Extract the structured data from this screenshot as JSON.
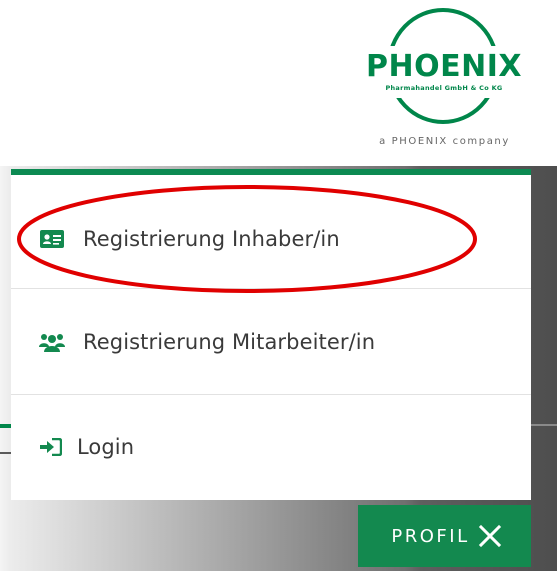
{
  "logo": {
    "name": "PHOENIX",
    "subtitle": "Pharmahandel GmbH & Co KG",
    "company_line": "a PHOENIX company",
    "brand_color": "#00864a"
  },
  "menu": {
    "accent_color": "#0c8a52",
    "items": [
      {
        "label": "Registrierung Inhaber/in",
        "icon": "id-card-icon"
      },
      {
        "label": "Registrierung Mitarbeiter/in",
        "icon": "users-icon"
      },
      {
        "label": "Login",
        "icon": "sign-in-icon"
      }
    ]
  },
  "highlight": {
    "color": "#e00000"
  },
  "profil_button": {
    "label": "PROFIL",
    "icon": "close-icon",
    "color": "#13894f"
  }
}
